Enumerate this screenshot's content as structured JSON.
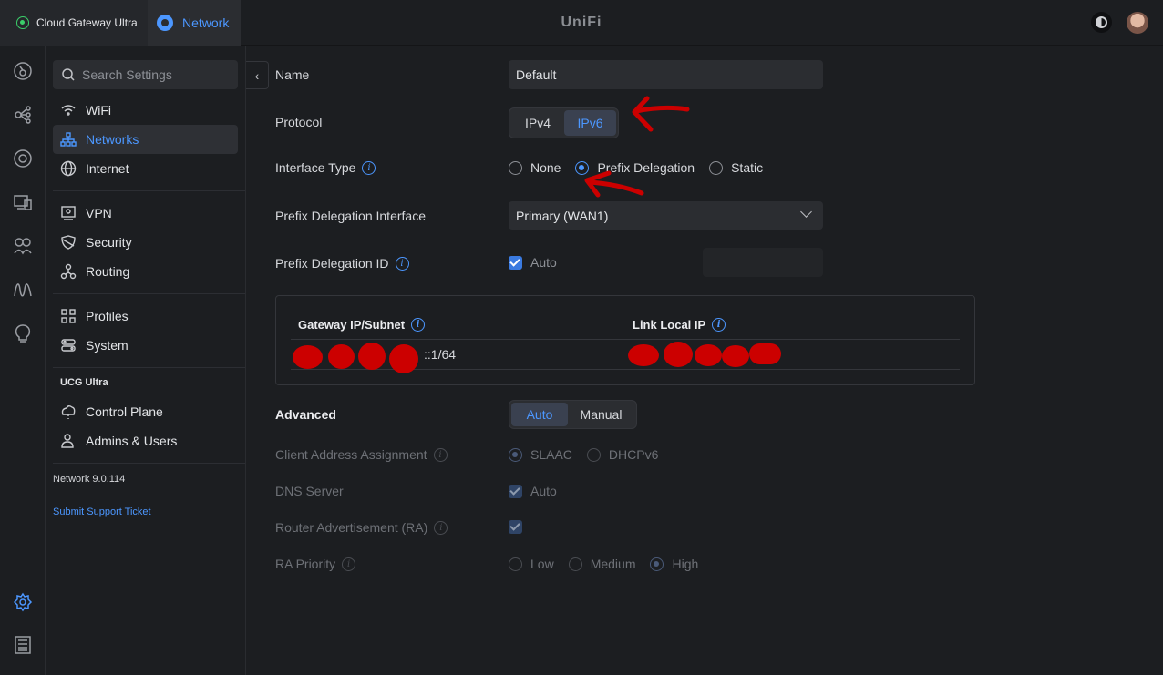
{
  "topbar": {
    "device_tab": "Cloud Gateway Ultra",
    "app_tab": "Network",
    "logo": "UniFi"
  },
  "sidebar": {
    "search_placeholder": "Search Settings",
    "items": [
      {
        "label": "WiFi",
        "icon": "wifi-icon"
      },
      {
        "label": "Networks",
        "icon": "networks-icon",
        "active": true
      },
      {
        "label": "Internet",
        "icon": "globe-icon"
      },
      {
        "label": "VPN",
        "icon": "vpn-icon"
      },
      {
        "label": "Security",
        "icon": "shield-icon"
      },
      {
        "label": "Routing",
        "icon": "routing-icon"
      },
      {
        "label": "Profiles",
        "icon": "profiles-icon"
      },
      {
        "label": "System",
        "icon": "system-icon"
      }
    ],
    "section": "UCG Ultra",
    "section_items": [
      {
        "label": "Control Plane",
        "icon": "control-plane-icon"
      },
      {
        "label": "Admins & Users",
        "icon": "admins-icon"
      }
    ],
    "version": "Network 9.0.114",
    "support_link": "Submit Support Ticket"
  },
  "form": {
    "name_label": "Name",
    "name_value": "Default",
    "protocol_label": "Protocol",
    "protocol_options": [
      "IPv4",
      "IPv6"
    ],
    "protocol_selected": "IPv6",
    "interface_type_label": "Interface Type",
    "interface_type_options": [
      "None",
      "Prefix Delegation",
      "Static"
    ],
    "interface_type_selected": "Prefix Delegation",
    "pd_interface_label": "Prefix Delegation Interface",
    "pd_interface_value": "Primary (WAN1)",
    "pd_id_label": "Prefix Delegation ID",
    "pd_id_auto_label": "Auto",
    "table": {
      "col1_header": "Gateway IP/Subnet",
      "col2_header": "Link Local IP",
      "col1_value_suffix": "::1/64"
    },
    "advanced_label": "Advanced",
    "advanced_options": [
      "Auto",
      "Manual"
    ],
    "advanced_selected": "Auto",
    "client_assign_label": "Client Address Assignment",
    "client_assign_options": [
      "SLAAC",
      "DHCPv6"
    ],
    "dns_label": "DNS Server",
    "dns_auto_label": "Auto",
    "ra_label": "Router Advertisement (RA)",
    "ra_priority_label": "RA Priority",
    "ra_priority_options": [
      "Low",
      "Medium",
      "High"
    ],
    "ra_priority_selected": "High"
  },
  "colors": {
    "accent": "#4c97ff",
    "annotation": "#cc0000",
    "background": "#1c1e21"
  }
}
